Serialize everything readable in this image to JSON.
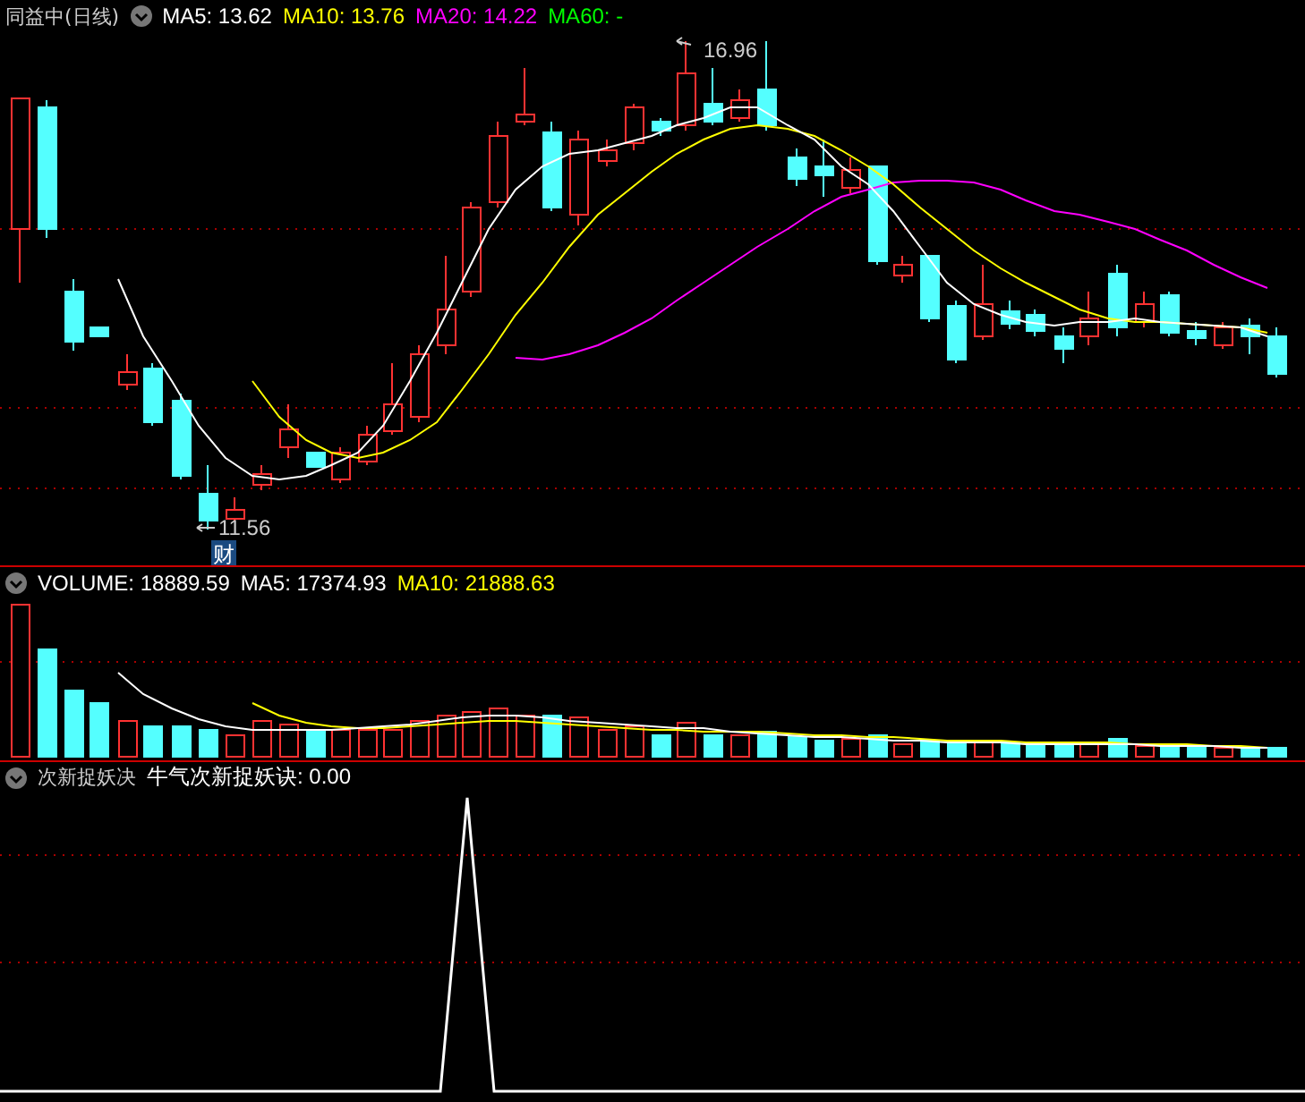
{
  "price_panel": {
    "title": "同益中(日线)",
    "ma_labels": [
      {
        "text": "MA5: 13.62",
        "color": "#ffffff"
      },
      {
        "text": "MA10: 13.76",
        "color": "#ffff00"
      },
      {
        "text": "MA20: 14.22",
        "color": "#ff00ff"
      },
      {
        "text": "MA60: -",
        "color": "#00ff00"
      }
    ],
    "high_label": "16.96",
    "low_label": "11.56",
    "badge": "财"
  },
  "volume_panel": {
    "labels": [
      {
        "text": "VOLUME: 18889.59",
        "color": "#ffffff"
      },
      {
        "text": "MA5: 17374.93",
        "color": "#ffffff"
      },
      {
        "text": "MA10: 21888.63",
        "color": "#ffff00"
      }
    ]
  },
  "indicator_panel": {
    "title": "次新捉妖决",
    "labels": [
      {
        "text": "牛气次新捉妖诀: 0.00",
        "color": "#ffffff"
      }
    ]
  }
}
